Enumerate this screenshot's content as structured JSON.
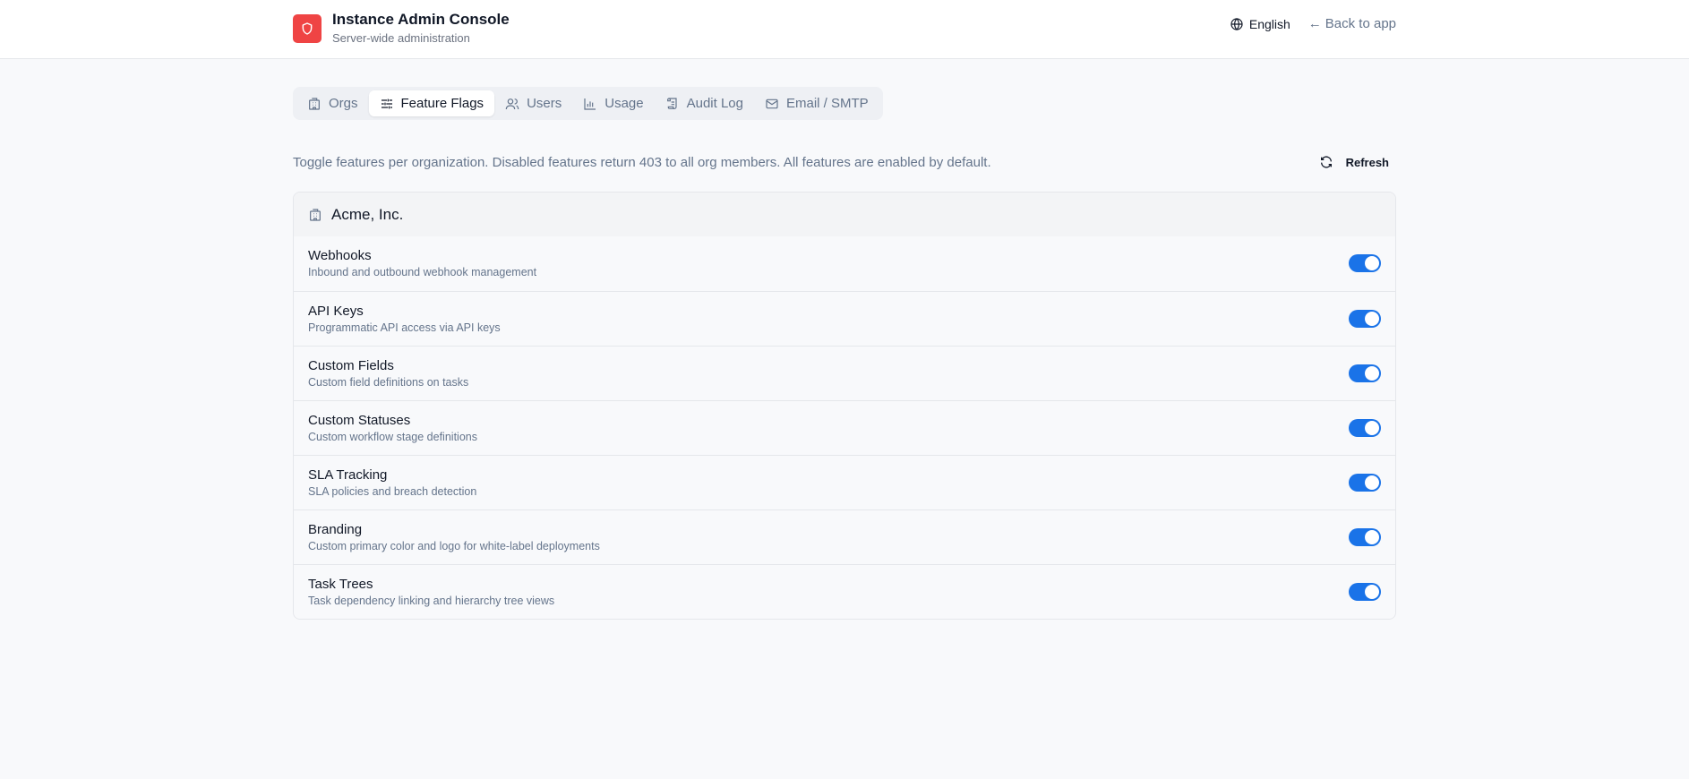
{
  "header": {
    "title": "Instance Admin Console",
    "subtitle": "Server-wide administration",
    "language": "English",
    "back_label": "Back to app",
    "brand_color": "#ef4444"
  },
  "tabs": [
    {
      "label": "Orgs",
      "icon": "building-icon",
      "active": false
    },
    {
      "label": "Feature Flags",
      "icon": "sliders-icon",
      "active": true
    },
    {
      "label": "Users",
      "icon": "users-icon",
      "active": false
    },
    {
      "label": "Usage",
      "icon": "bar-chart-icon",
      "active": false
    },
    {
      "label": "Audit Log",
      "icon": "scroll-icon",
      "active": false
    },
    {
      "label": "Email / SMTP",
      "icon": "mail-icon",
      "active": false
    }
  ],
  "description": "Toggle features per organization. Disabled features return 403 to all org members. All features are enabled by default.",
  "refresh_label": "Refresh",
  "org": {
    "name": "Acme, Inc.",
    "features": [
      {
        "name": "Webhooks",
        "description": "Inbound and outbound webhook management",
        "enabled": true
      },
      {
        "name": "API Keys",
        "description": "Programmatic API access via API keys",
        "enabled": true
      },
      {
        "name": "Custom Fields",
        "description": "Custom field definitions on tasks",
        "enabled": true
      },
      {
        "name": "Custom Statuses",
        "description": "Custom workflow stage definitions",
        "enabled": true
      },
      {
        "name": "SLA Tracking",
        "description": "SLA policies and breach detection",
        "enabled": true
      },
      {
        "name": "Branding",
        "description": "Custom primary color and logo for white-label deployments",
        "enabled": true
      },
      {
        "name": "Task Trees",
        "description": "Task dependency linking and hierarchy tree views",
        "enabled": true
      }
    ]
  },
  "colors": {
    "toggle_on": "#1a73e8",
    "accent": "#ef4444"
  }
}
